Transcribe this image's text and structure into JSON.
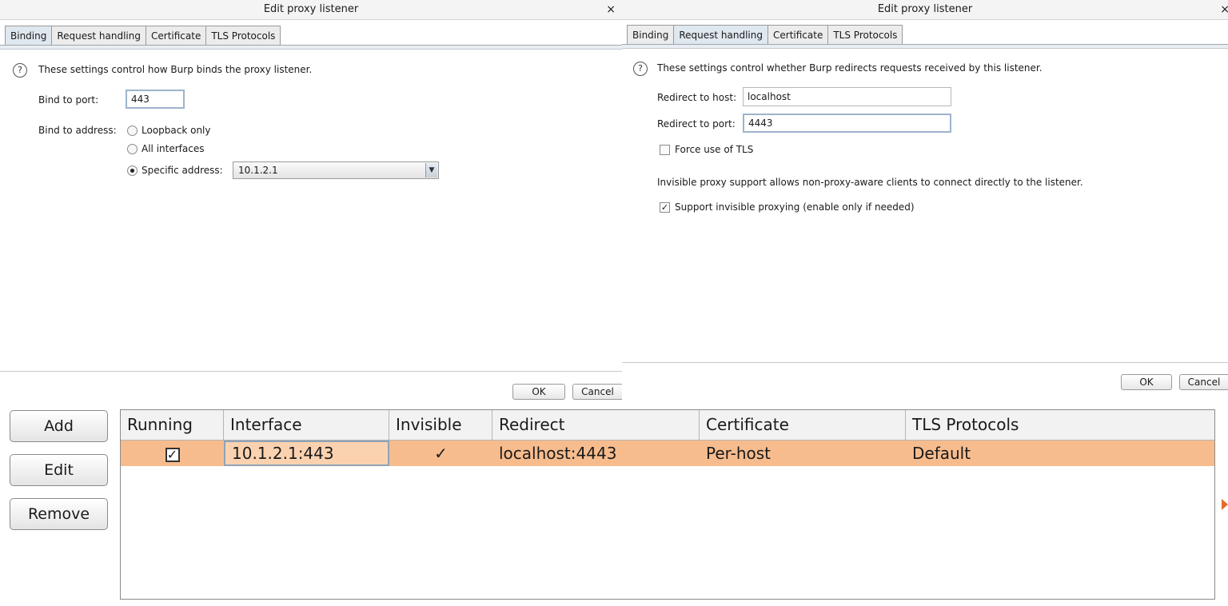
{
  "left_dialog": {
    "title": "Edit proxy listener",
    "close": "×",
    "tabs": [
      "Binding",
      "Request handling",
      "Certificate",
      "TLS Protocols"
    ],
    "active_tab": "Binding",
    "help": "?",
    "description": "These settings control how Burp binds the proxy listener.",
    "port_label": "Bind to port:",
    "port_value": "443",
    "address_label": "Bind to address:",
    "radio_loopback": "Loopback only",
    "radio_all": "All interfaces",
    "radio_specific": "Specific address:",
    "selected_radio": "Specific address:",
    "specific_value": "10.1.2.1",
    "dropdown_arrow": "▼",
    "ok": "OK",
    "cancel": "Cancel"
  },
  "right_dialog": {
    "title": "Edit proxy listener",
    "close": "×",
    "tabs": [
      "Binding",
      "Request handling",
      "Certificate",
      "TLS Protocols"
    ],
    "active_tab": "Request handling",
    "help": "?",
    "description": "These settings control whether Burp redirects requests received by this listener.",
    "host_label": "Redirect to host:",
    "host_value": "localhost",
    "port_label": "Redirect to port:",
    "port_value": "4443",
    "force_tls_label": "Force use of TLS",
    "force_tls_checked": false,
    "invisible_info": "Invisible proxy support allows non-proxy-aware clients to connect directly to the listener.",
    "invisible_label": "Support invisible proxying (enable only if needed)",
    "invisible_checked": true,
    "check_mark": "✓",
    "ok": "OK",
    "cancel": "Cancel"
  },
  "listeners": {
    "buttons": {
      "add": "Add",
      "edit": "Edit",
      "remove": "Remove"
    },
    "columns": [
      "Running",
      "Interface",
      "Invisible",
      "Redirect",
      "Certificate",
      "TLS Protocols"
    ],
    "rows": [
      {
        "running": "✓",
        "interface": "10.1.2.1:443",
        "invisible": "✓",
        "redirect": "localhost:4443",
        "certificate": "Per-host",
        "tls": "Default"
      }
    ],
    "row_highlight": "#f7bc8e"
  }
}
